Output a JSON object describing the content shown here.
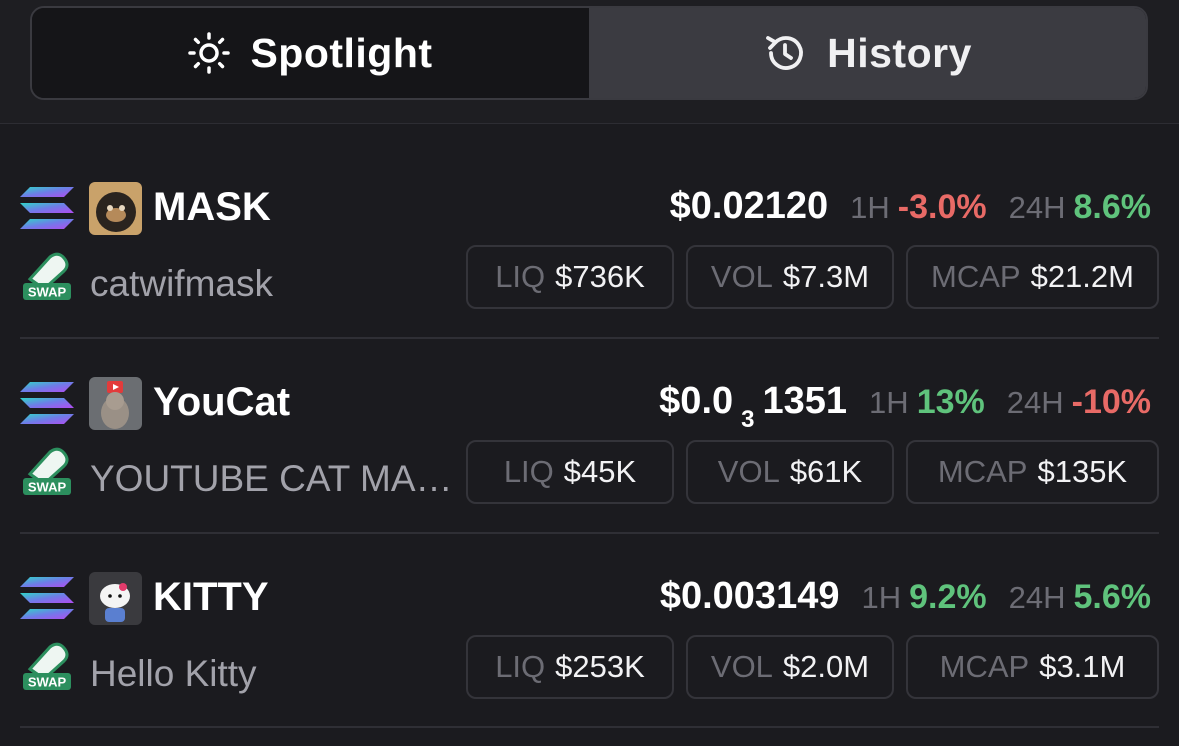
{
  "tabs": {
    "spotlight": {
      "label": "Spotlight",
      "icon": "sun-icon",
      "active": true
    },
    "history": {
      "label": "History",
      "icon": "history-icon",
      "active": false
    }
  },
  "colors": {
    "negative": "#e86a66",
    "positive": "#5fc37c",
    "background": "#1b1b1f"
  },
  "tokens": [
    {
      "symbol": "MASK",
      "name": "catwifmask",
      "price": "$0.02120",
      "price_sub": "",
      "price_tail": "",
      "h1_label": "1H",
      "h1": "-3.0%",
      "h1_dir": "neg",
      "h24_label": "24H",
      "h24": "8.6%",
      "h24_dir": "pos",
      "liq_label": "LIQ",
      "liq": "$736K",
      "vol_label": "VOL",
      "vol": "$7.3M",
      "mcap_label": "MCAP",
      "mcap": "$21.2M",
      "chain_icon": "solana-icon",
      "dex_icon": "swap-icon"
    },
    {
      "symbol": "YouCat",
      "name": "YOUTUBE CAT MA…",
      "price": "$0.0",
      "price_sub": "3",
      "price_tail": "1351",
      "h1_label": "1H",
      "h1": "13%",
      "h1_dir": "pos",
      "h24_label": "24H",
      "h24": "-10%",
      "h24_dir": "neg",
      "liq_label": "LIQ",
      "liq": "$45K",
      "vol_label": "VOL",
      "vol": "$61K",
      "mcap_label": "MCAP",
      "mcap": "$135K",
      "chain_icon": "solana-icon",
      "dex_icon": "swap-icon"
    },
    {
      "symbol": "KITTY",
      "name": "Hello Kitty",
      "price": "$0.003149",
      "price_sub": "",
      "price_tail": "",
      "h1_label": "1H",
      "h1": "9.2%",
      "h1_dir": "pos",
      "h24_label": "24H",
      "h24": "5.6%",
      "h24_dir": "pos",
      "liq_label": "LIQ",
      "liq": "$253K",
      "vol_label": "VOL",
      "vol": "$2.0M",
      "mcap_label": "MCAP",
      "mcap": "$3.1M",
      "chain_icon": "solana-icon",
      "dex_icon": "swap-icon"
    }
  ]
}
